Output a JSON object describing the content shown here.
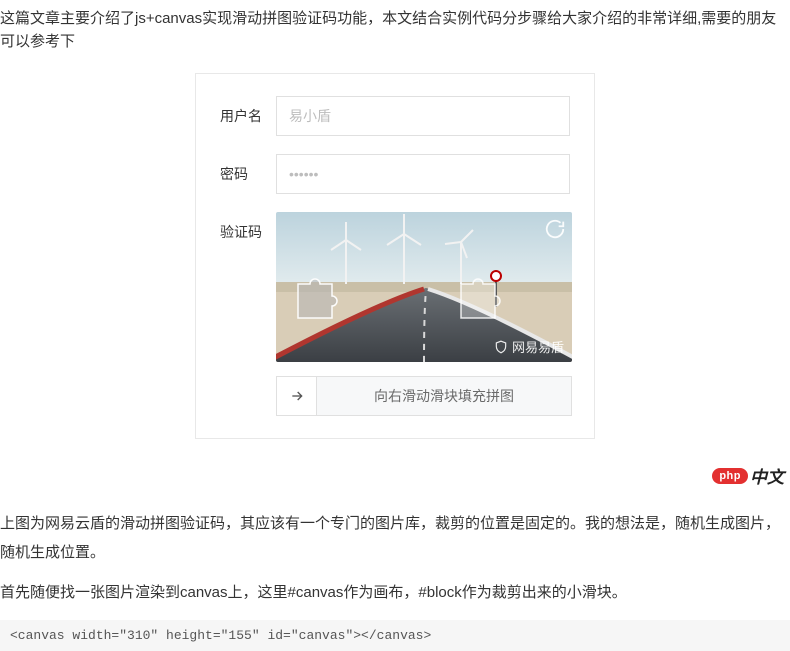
{
  "intro": "这篇文章主要介绍了js+canvas实现滑动拼图验证码功能，本文结合实例代码分步骤给大家介绍的非常详细,需要的朋友可以参考下",
  "form": {
    "username_label": "用户名",
    "username_placeholder": "易小盾",
    "password_label": "密码",
    "password_placeholder": "••••••",
    "captcha_label": "验证码",
    "slider_hint": "向右滑动滑块填充拼图",
    "captcha_watermark": "网易易盾"
  },
  "logo": {
    "pill": "php",
    "suffix": "中文"
  },
  "para1": "上图为网易云盾的滑动拼图验证码，其应该有一个专门的图片库，裁剪的位置是固定的。我的想法是，随机生成图片，随机生成位置。",
  "para2": "首先随便找一张图片渲染到canvas上，这里#canvas作为画布，#block作为裁剪出来的小滑块。",
  "code": "<canvas width=\"310\" height=\"155\" id=\"canvas\"></canvas>"
}
